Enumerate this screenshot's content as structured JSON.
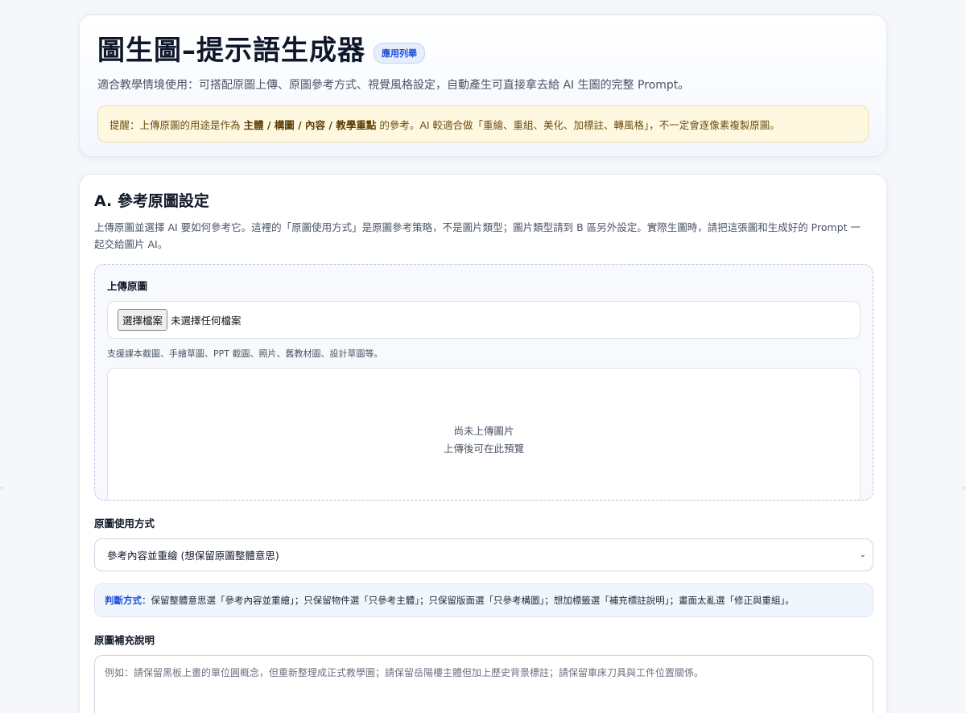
{
  "header": {
    "title": "圖生圖–提示語生成器",
    "badge": "應用列舉",
    "subtitle": "適合教學情境使用：可搭配原圖上傳、原圖參考方式、視覺風格設定，自動產生可直接拿去給 AI 生圖的完整 Prompt。",
    "reminder_prefix": "提醒：上傳原圖的用途是作為",
    "reminder_bold": "主體 / 構圖 / 內容 / 教學重點",
    "reminder_suffix": "的參考。AI 較適合做「重繪、重組、美化、加標註、轉風格」，不一定會逐像素複製原圖。"
  },
  "sectionA": {
    "title": "A. 參考原圖設定",
    "description": "上傳原圖並選擇 AI 要如何參考它。這裡的「原圖使用方式」是原圖參考策略，不是圖片類型；圖片類型請到 B 區另外設定。實際生圖時，請把這張圖和生成好的 Prompt 一起交給圖片 AI。",
    "upload": {
      "label": "上傳原圖",
      "button": "選擇檔案",
      "status": "未選擇任何檔案",
      "hint": "支援課本截圖、手繪草圖、PPT 截圖、照片、舊教材圖、設計草圖等。",
      "preview_line1": "尚未上傳圖片",
      "preview_line2": "上傳後可在此預覽"
    },
    "usage": {
      "label": "原圖使用方式",
      "selected": "參考內容並重繪 (想保留原圖整體意思)"
    },
    "judge": {
      "key": "判斷方式",
      "text": "：保留整體意思選「參考內容並重繪」；只保留物件選「只參考主體」；只保留版面選「只參考構圖」；想加標籤選「補充標註說明」；畫面太亂選「修正與重組」。"
    },
    "note": {
      "label": "原圖補充說明",
      "placeholder": "例如：請保留黑板上畫的單位圓概念，但重新整理成正式教學圖；請保留岳陽樓主體但加上歷史背景標註；請保留車床刀具與工件位置關係。"
    }
  }
}
